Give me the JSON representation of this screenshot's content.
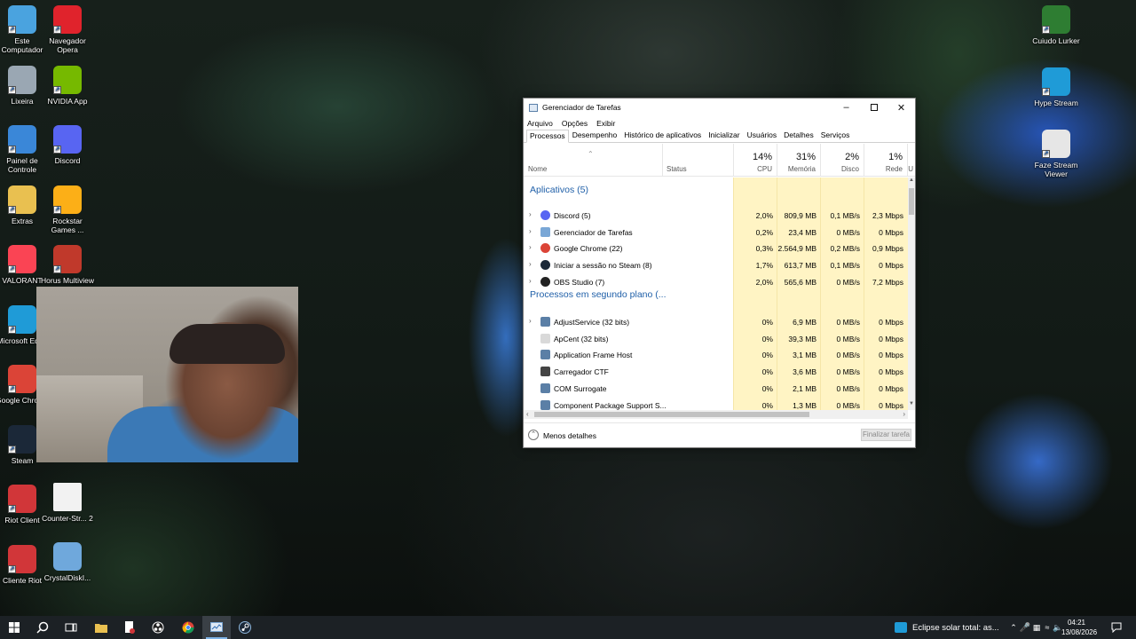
{
  "desktop": {
    "icons_left_col1": [
      {
        "label": "Este Computador",
        "icon": "computer-icon",
        "color": "#4aa3df"
      },
      {
        "label": "Lixeira",
        "icon": "recycle-bin-icon",
        "color": "#9aa7b3"
      },
      {
        "label": "Painel de Controle",
        "icon": "control-panel-icon",
        "color": "#3a87d8"
      },
      {
        "label": "Extras",
        "icon": "folder-icon",
        "color": "#e9c050"
      },
      {
        "label": "VALORANT",
        "icon": "valorant-icon",
        "color": "#fa4454"
      },
      {
        "label": "Microsoft Edge",
        "icon": "edge-icon",
        "color": "#1f9bd7"
      },
      {
        "label": "Google Chrome",
        "icon": "chrome-icon",
        "color": "#db4437"
      },
      {
        "label": "Steam",
        "icon": "steam-icon",
        "color": "#1b2838"
      },
      {
        "label": "Riot Client",
        "icon": "riot-icon",
        "color": "#d13639"
      },
      {
        "label": "Cliente Riot",
        "icon": "riot-icon",
        "color": "#d13639"
      }
    ],
    "icons_left_col2": [
      {
        "label": "Navegador Opera",
        "icon": "opera-icon",
        "color": "#e0232c"
      },
      {
        "label": "NVIDIA App",
        "icon": "nvidia-icon",
        "color": "#76b900"
      },
      {
        "label": "Discord",
        "icon": "discord-icon",
        "color": "#5865f2"
      },
      {
        "label": "Rockstar Games ...",
        "icon": "rockstar-icon",
        "color": "#fcaf17"
      },
      {
        "label": "Horus Multiview",
        "icon": "horus-icon",
        "color": "#c0392b"
      },
      {
        "label": "Counter-Str... 2",
        "icon": "file-icon",
        "color": "#f2f2f2"
      },
      {
        "label": "CrystalDiskI...",
        "icon": "crystaldisk-icon",
        "color": "#6fa8dc"
      }
    ],
    "icons_right": [
      {
        "label": "Cuiudo Lurker",
        "icon": "cuiudo-lurker-icon",
        "color": "#2e7d32"
      },
      {
        "label": "Hype Stream",
        "icon": "hype-stream-icon",
        "color": "#1f9bd7"
      },
      {
        "label": "Faze Stream Viewer",
        "icon": "faze-icon",
        "color": "#e6e6e6"
      }
    ]
  },
  "taskmgr": {
    "title": "Gerenciador de Tarefas",
    "menu": [
      "Arquivo",
      "Opções",
      "Exibir"
    ],
    "tabs": [
      "Processos",
      "Desempenho",
      "Histórico de aplicativos",
      "Inicializar",
      "Usuários",
      "Detalhes",
      "Serviços"
    ],
    "columns": {
      "name": "Nome",
      "status": "Status",
      "cpu": {
        "pct": "14%",
        "label": "CPU"
      },
      "mem": {
        "pct": "31%",
        "label": "Memória"
      },
      "disk": {
        "pct": "2%",
        "label": "Disco"
      },
      "net": {
        "pct": "1%",
        "label": "Rede"
      },
      "extra": "U"
    },
    "group_apps": "Aplicativos (5)",
    "apps": [
      {
        "name": "Discord (5)",
        "cpu": "2,0%",
        "mem": "809,9 MB",
        "disk": "0,1 MB/s",
        "net": "2,3 Mbps",
        "icon": "discord-icon",
        "color": "#5865f2"
      },
      {
        "name": "Gerenciador de Tarefas",
        "cpu": "0,2%",
        "mem": "23,4 MB",
        "disk": "0 MB/s",
        "net": "0 Mbps",
        "icon": "task-manager-icon",
        "color": "#7aa7d6"
      },
      {
        "name": "Google Chrome (22)",
        "cpu": "0,3%",
        "mem": "2.564,9 MB",
        "disk": "0,2 MB/s",
        "net": "0,9 Mbps",
        "icon": "chrome-icon",
        "color": "#db4437"
      },
      {
        "name": "Iniciar a sessão no Steam (8)",
        "cpu": "1,7%",
        "mem": "613,7 MB",
        "disk": "0,1 MB/s",
        "net": "0 Mbps",
        "icon": "steam-icon",
        "color": "#1b2838"
      },
      {
        "name": "OBS Studio (7)",
        "cpu": "2,0%",
        "mem": "565,6 MB",
        "disk": "0 MB/s",
        "net": "7,2 Mbps",
        "icon": "obs-icon",
        "color": "#222222"
      }
    ],
    "group_bg": "Processos em segundo plano (...",
    "background": [
      {
        "name": "AdjustService (32 bits)",
        "cpu": "0%",
        "mem": "6,9 MB",
        "disk": "0 MB/s",
        "net": "0 Mbps",
        "expand": true,
        "icon": "service-icon",
        "color": "#5b7fa6"
      },
      {
        "name": "ApCent (32 bits)",
        "cpu": "0%",
        "mem": "39,3 MB",
        "disk": "0 MB/s",
        "net": "0 Mbps",
        "expand": false,
        "icon": "process-icon",
        "color": "#d9d9d9"
      },
      {
        "name": "Application Frame Host",
        "cpu": "0%",
        "mem": "3,1 MB",
        "disk": "0 MB/s",
        "net": "0 Mbps",
        "expand": false,
        "icon": "service-icon",
        "color": "#5b7fa6"
      },
      {
        "name": "Carregador CTF",
        "cpu": "0%",
        "mem": "3,6 MB",
        "disk": "0 MB/s",
        "net": "0 Mbps",
        "expand": false,
        "icon": "pen-icon",
        "color": "#444444"
      },
      {
        "name": "COM Surrogate",
        "cpu": "0%",
        "mem": "2,1 MB",
        "disk": "0 MB/s",
        "net": "0 Mbps",
        "expand": false,
        "icon": "service-icon",
        "color": "#5b7fa6"
      },
      {
        "name": "Component Package Support S...",
        "cpu": "0%",
        "mem": "1,3 MB",
        "disk": "0 MB/s",
        "net": "0 Mbps",
        "expand": false,
        "icon": "service-icon",
        "color": "#5b7fa6"
      }
    ],
    "footer": {
      "less": "Menos detalhes",
      "end_task": "Finalizar tarefa"
    }
  },
  "taskbar": {
    "news": "Eclipse solar total: as...",
    "time": "04:21",
    "date": "13/08/2026",
    "accent": "#7fb4e8"
  }
}
